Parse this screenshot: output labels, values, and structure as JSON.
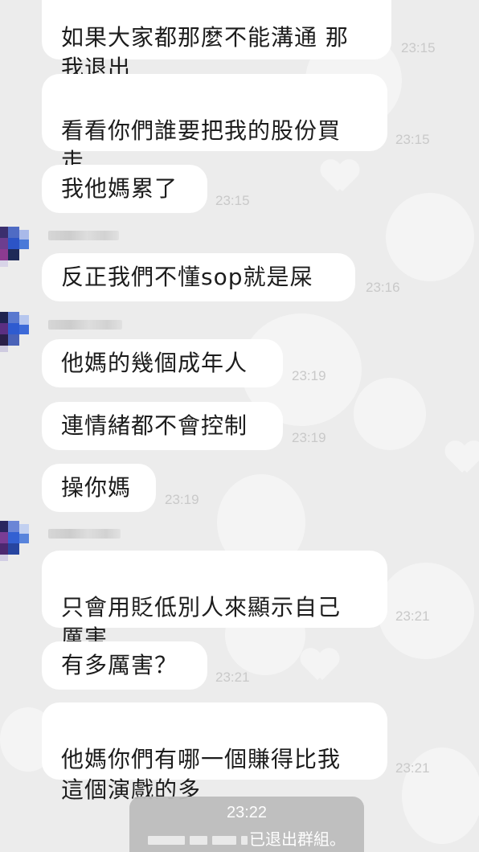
{
  "messages": [
    {
      "text": "如果大家都那麼不能溝通 那\n我退出",
      "time": "23:15"
    },
    {
      "text": "看看你們誰要把我的股份買\n走",
      "time": "23:15"
    },
    {
      "text": "我他媽累了",
      "time": "23:15"
    },
    {
      "text": "反正我們不懂sop就是屎",
      "time": "23:16"
    },
    {
      "text": "他媽的幾個成年人",
      "time": "23:19"
    },
    {
      "text": "連情緒都不會控制",
      "time": "23:19"
    },
    {
      "text": "操你媽",
      "time": "23:19"
    },
    {
      "text": "只會用貶低別人來顯示自己\n厲害",
      "time": "23:21"
    },
    {
      "text": "有多厲害？",
      "time": "23:21"
    },
    {
      "text": "他媽你們有哪一個賺得比我\n這個演戲的多",
      "time": "23:21"
    }
  ],
  "system_notice": {
    "time": "23:22",
    "text": "已退出群組。"
  },
  "colors": {
    "background": "#ececec",
    "bubble": "#ffffff",
    "timestamp": "#c9c9c9",
    "system_bubble": "#bdbdbd"
  }
}
